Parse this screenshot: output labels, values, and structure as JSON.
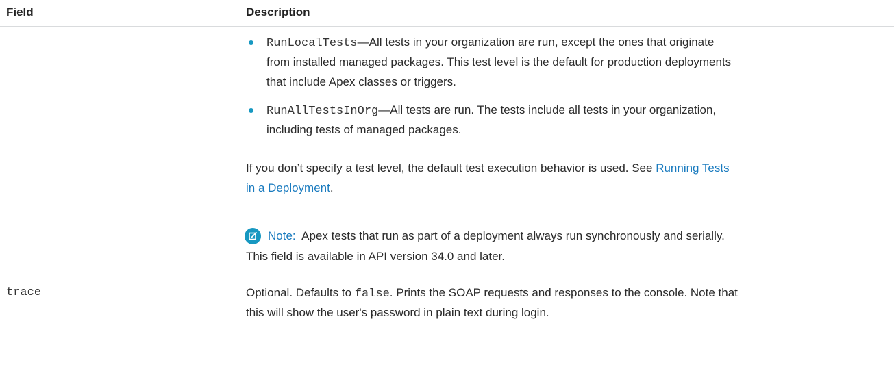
{
  "table": {
    "headers": {
      "field": "Field",
      "description": "Description"
    },
    "rows": [
      {
        "field": "",
        "bullets": [
          {
            "code": "RunLocalTests",
            "text_lines": [
              "—All tests in your organization are run, except the ones that originate",
              "from installed managed packages. This test level is the default for production deployments",
              "that include Apex classes or triggers."
            ]
          },
          {
            "code": "RunAllTestsInOrg",
            "text_lines": [
              "—All tests are run. The tests include all tests in your organization,",
              "including tests of managed packages."
            ]
          }
        ],
        "paragraph": {
          "line1_text": "If you don’t specify a test level, the default test execution behavior is used. See ",
          "link_line1": "Running Tests",
          "link_line2": "in a Deployment",
          "line2_after": "."
        },
        "note": {
          "label": "Note:",
          "text": "Apex tests that run as part of a deployment always run synchronously and serially.",
          "icon": "edit-note-icon"
        },
        "availability": "This field is available in API version 34.0 and later."
      },
      {
        "field": "trace",
        "description": {
          "line1_before": "Optional. Defaults to ",
          "line1_code": "false",
          "line1_after": ". Prints the SOAP requests and responses to the console. Note that",
          "line2": "this will show the user's password in plain text during login."
        }
      }
    ]
  },
  "colors": {
    "accent": "#1798c1",
    "link": "#1a7bbf",
    "divider": "#d9dbdd"
  }
}
